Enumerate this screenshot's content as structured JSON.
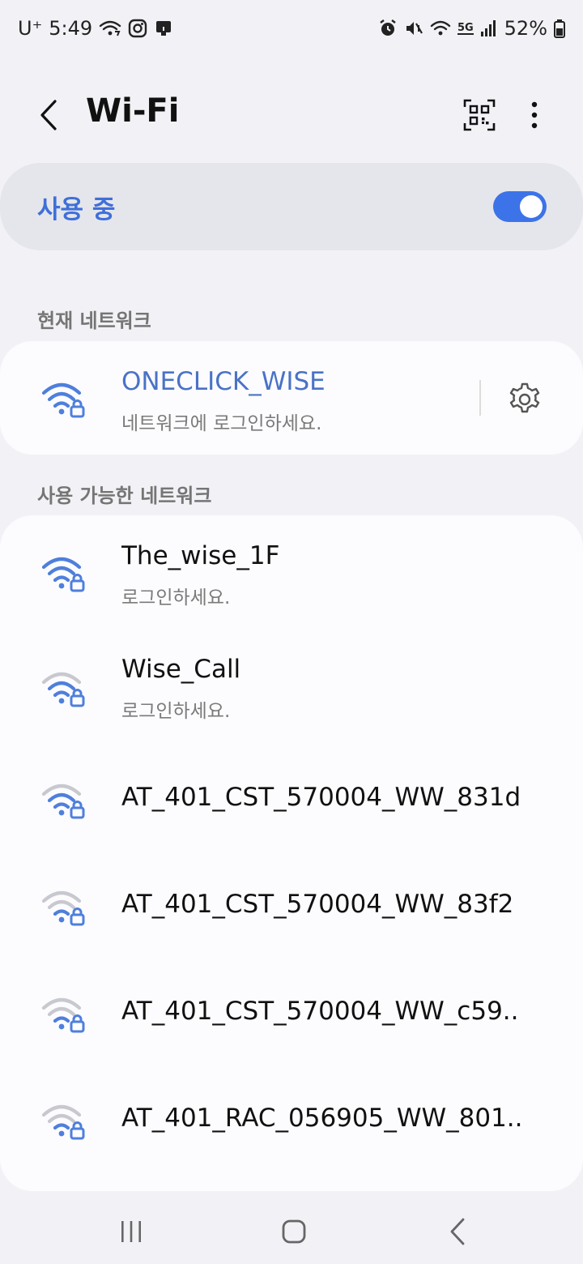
{
  "status_bar": {
    "carrier": "U⁺",
    "time": "5:49",
    "battery": "52%",
    "network_type": "5G"
  },
  "header": {
    "title": "Wi-Fi"
  },
  "master": {
    "label": "사용 중",
    "enabled": true
  },
  "current_section": {
    "title": "현재 네트워크",
    "network": {
      "name": "ONECLICK_WISE",
      "status": "네트워크에 로그인하세요."
    }
  },
  "available_section": {
    "title": "사용 가능한 네트워크",
    "networks": [
      {
        "name": "The_wise_1F",
        "status": "로그인하세요."
      },
      {
        "name": "Wise_Call",
        "status": "로그인하세요."
      },
      {
        "name": "AT_401_CST_570004_WW_831d"
      },
      {
        "name": "AT_401_CST_570004_WW_83f2"
      },
      {
        "name": "AT_401_CST_570004_WW_c59.."
      },
      {
        "name": "AT_401_RAC_056905_WW_801.."
      }
    ]
  },
  "colors": {
    "accent": "#3d73e8",
    "current_name": "#4a72c6",
    "wifi_strong": "#4f7fdc",
    "wifi_weak": "#c7c9cf"
  }
}
